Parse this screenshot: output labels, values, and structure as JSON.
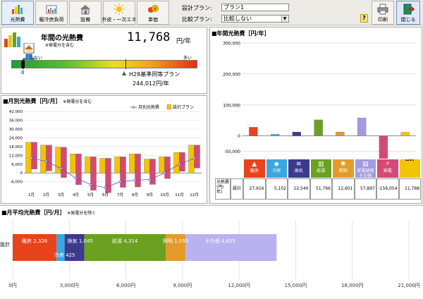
{
  "toolbar": {
    "buttons": [
      {
        "label": "光熱費",
        "icon": "energy-cost-icon"
      },
      {
        "label": "暖冷房負荷",
        "icon": "heating-load-icon"
      },
      {
        "label": "設備",
        "icon": "house-equipment-icon"
      },
      {
        "label": "外皮・一次エネ",
        "icon": "sun-icon"
      },
      {
        "label": "単価",
        "icon": "yen-price-icon"
      }
    ],
    "design_plan_label": "設計プラン:",
    "design_plan_value": "プラン1",
    "compare_plan_label": "比較プラン:",
    "compare_plan_value": "比較しない",
    "help_label": "?",
    "print_label": "印刷",
    "close_label": "閉じる"
  },
  "annual_cost": {
    "title": "年間の光熱費",
    "note": "※発電分を含む",
    "value": "11,768",
    "unit": "円/年",
    "scale_low": "少ない",
    "scale_high": "多い",
    "scale_zero": "0",
    "benchmark_label": "H28基準同等プラン",
    "benchmark_value": "244,012円/年"
  },
  "panel_titles": {
    "annual_chart": "■年間光熱費［円/年］",
    "monthly_chart": "■月別光熱費［円/月］",
    "monthly_chart_note": "※発電分を含む",
    "avg_chart": "■月平均光熱費［円/月］",
    "avg_chart_note": "※発電分を除く"
  },
  "category_table": {
    "row_header": "光熱費(円/年)",
    "plan_header": "設計",
    "columns": [
      {
        "label": "暖房",
        "value": "27,916",
        "color": "#e8431b"
      },
      {
        "label": "冷房",
        "value": "5,102",
        "color": "#3aa7e0"
      },
      {
        "label": "換気",
        "value": "12,540",
        "color": "#3c3a8e"
      },
      {
        "label": "給湯",
        "value": "51,766",
        "color": "#6aa121"
      },
      {
        "label": "照明",
        "value": "12,601",
        "color": "#e49b2c"
      },
      {
        "label": "家電調理その他",
        "value": "57,897",
        "color": "#a39ae0"
      },
      {
        "label": "発電",
        "value": "-156,054",
        "color": "#d54a74"
      },
      {
        "label": "合計",
        "value": "11,768",
        "color": "#f5c400"
      }
    ]
  },
  "chart_data": [
    {
      "type": "bar",
      "categories": [
        "暖房",
        "冷房",
        "換気",
        "給湯",
        "照明",
        "家電調理その他",
        "発電",
        "合計"
      ],
      "values": [
        27916,
        5102,
        12540,
        51766,
        12601,
        57897,
        -156054,
        11768
      ],
      "ylim": [
        -60000,
        300000
      ],
      "yticks": [
        "300,000",
        "200,000",
        "100,000",
        "0",
        "-50,000"
      ],
      "ytick_values": [
        300000,
        200000,
        100000,
        0,
        -50000
      ],
      "grid": true
    },
    {
      "type": "bar",
      "categories": [
        "1月",
        "2月",
        "3月",
        "4月",
        "5月",
        "6月",
        "7月",
        "8月",
        "9月",
        "10月",
        "11月",
        "12月"
      ],
      "series": [
        {
          "name": "月別光熱費",
          "kind": "line",
          "color": "#6a4ec0",
          "values": [
            10000,
            8000,
            3000,
            -3500,
            -8000,
            -10000,
            -6000,
            -5000,
            -4500,
            0,
            6000,
            10000
          ]
        },
        {
          "name": "設計プラン",
          "kind": "bar",
          "color": "#f5c400",
          "values": [
            21000,
            19000,
            17500,
            13000,
            11000,
            10000,
            11000,
            13000,
            9500,
            11000,
            14000,
            19000
          ]
        },
        {
          "name": "発電",
          "kind": "bar",
          "color": "#d54a74",
          "values": [
            -11000,
            -11000,
            -14500,
            -16500,
            -19000,
            -20000,
            -17000,
            -18000,
            -14000,
            -11000,
            -8000,
            -9000
          ]
        }
      ],
      "ylim": [
        -10000,
        42000
      ],
      "yticks": [
        "42,000",
        "36,000",
        "30,000",
        "24,000",
        "18,000",
        "12,000",
        "6,000",
        "0",
        "-6,000"
      ],
      "ytick_values": [
        42000,
        36000,
        30000,
        24000,
        18000,
        12000,
        6000,
        0,
        -6000
      ],
      "legend": "top-right"
    },
    {
      "type": "bar",
      "orientation": "horizontal-stacked",
      "categories": [
        "設計"
      ],
      "segments": [
        {
          "name": "暖房",
          "value": 2326,
          "color": "#e8431b"
        },
        {
          "name": "冷房",
          "value": 425,
          "color": "#3aa7e0"
        },
        {
          "name": "換気",
          "value": 1045,
          "color": "#3c3a8e"
        },
        {
          "name": "給湯",
          "value": 4314,
          "color": "#6aa121"
        },
        {
          "name": "照明",
          "value": 1050,
          "color": "#e49b2c"
        },
        {
          "name": "その他",
          "value": 4825,
          "color": "#b8b2f0"
        }
      ],
      "segment_labels": [
        "暖房 2,326",
        "冷房 425",
        "換気 1,045",
        "給湯 4,314",
        "照明 1,050",
        "その他 4,825"
      ],
      "xlim": [
        0,
        21000
      ],
      "xticks": [
        "0円",
        "3,000円",
        "6,000円",
        "9,000円",
        "12,000円",
        "15,000円",
        "18,000円",
        "21,000円"
      ],
      "xtick_values": [
        0,
        3000,
        6000,
        9000,
        12000,
        15000,
        18000,
        21000
      ],
      "grid": true
    }
  ]
}
